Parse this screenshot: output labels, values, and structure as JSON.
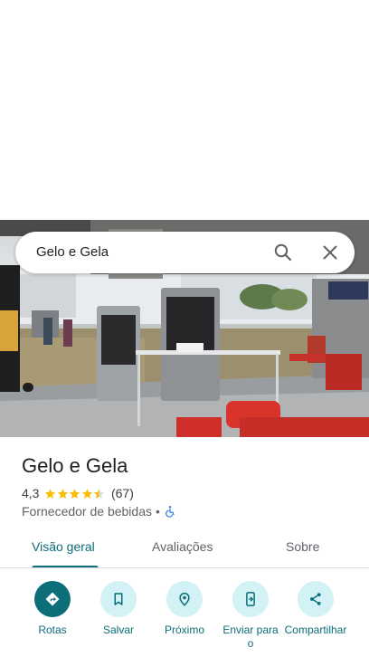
{
  "search": {
    "query": "Gelo e Gela"
  },
  "place": {
    "name": "Gelo e Gela",
    "rating": "4,3",
    "rating_value": 4.3,
    "stars_filled": 4.5,
    "review_count": "(67)",
    "category": "Fornecedor de bebidas",
    "separator": "•"
  },
  "tabs": [
    {
      "label": "Visão geral",
      "active": true
    },
    {
      "label": "Avaliações",
      "active": false
    },
    {
      "label": "Sobre",
      "active": false
    }
  ],
  "actions": [
    {
      "label": "Rotas",
      "icon": "directions-icon",
      "primary": true
    },
    {
      "label": "Salvar",
      "icon": "bookmark-icon",
      "primary": false
    },
    {
      "label": "Próximo",
      "icon": "nearby-icon",
      "primary": false
    },
    {
      "label": "Enviar para o",
      "icon": "send-to-phone-icon",
      "primary": false
    },
    {
      "label": "Compartilhar",
      "icon": "share-icon",
      "primary": false
    }
  ],
  "colors": {
    "accent": "#0b6e79",
    "accent_light": "#d2f2f6",
    "star": "#fbbc04",
    "wheelchair": "#1a73e8"
  }
}
